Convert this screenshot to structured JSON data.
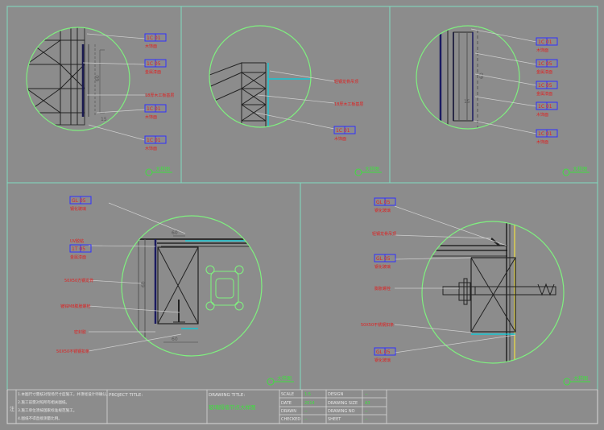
{
  "tags": {
    "t1": "1C 01",
    "t2": "1C 05",
    "t3": "1C 01",
    "t4": "1C 01",
    "t5": "1C 01",
    "t6": "1C 01",
    "t7": "1C 05",
    "t8": "1C 05",
    "t9": "1C 01",
    "t10": "1C 01",
    "t11": "GL 05",
    "t12": "1T 05",
    "t13": "GL 05",
    "t14": "GL 05",
    "t15": "GL 05",
    "t16": "GL 05"
  },
  "texts": {
    "a": "木饰面",
    "b": "金属漆面",
    "c": "18厚木工板基层",
    "d": "木饰面",
    "e": "木饰面",
    "f": "轻钢龙骨吊顶",
    "g": "18厚木工板基层",
    "h": "木饰面",
    "i": "木饰面",
    "j": "金属漆面",
    "k": "金属漆面",
    "l": "木饰面",
    "m": "木饰面",
    "n": "钢化玻璃",
    "o": "UV胶粘",
    "p": "金属漆面",
    "q": "50X50方钢龙骨",
    "r": "镀锌M8膨胀螺栓",
    "s": "密封胶",
    "t": "50X50不锈钢扣条",
    "u": "钢化玻璃",
    "v": "轻钢龙骨吊顶",
    "w": "钢化玻璃",
    "x": "膨胀螺栓",
    "y": "50X50不锈钢扣条",
    "z": "钢化玻璃"
  },
  "callouts": {
    "c1": "大样图",
    "c2": "大样图",
    "c3": "大样图",
    "c4": "大样图",
    "c5": "大样图"
  },
  "dims": {
    "d1": "60",
    "d2": "15",
    "d3": "60",
    "d4": "15",
    "d5": "60",
    "d6": "60"
  },
  "notes": {
    "n1": "1.本图尺寸需核对现场尺寸后施工，并须经设计师确认。",
    "n2": "2.施工前需对照所有相关图纸。",
    "n3": "3.施工单位须按国家标准规范施工。",
    "n4": "4.图纸不得直接测量比例。"
  },
  "titleblock": {
    "project_title": "PROJECT TITLE:",
    "drawing_title": "DRAWING TITLE:",
    "drawing_name": "玻璃隔墙节点大样图",
    "scale": "SCALE",
    "date": "DATE",
    "drawn": "DRAWN",
    "checked": "CHECKED",
    "design": "DESIGN",
    "drawing_size": "DRAWING SIZE",
    "drawing_no": "DRAWING NO",
    "sheet": "SHEET",
    "scale_v": "1:5",
    "date_v": "2014",
    "drawn_v": "--",
    "checked_v": "--",
    "design_v": "--",
    "size_v": "A3",
    "no_v": "--",
    "sheet_v": "--"
  },
  "notes_label": "注"
}
